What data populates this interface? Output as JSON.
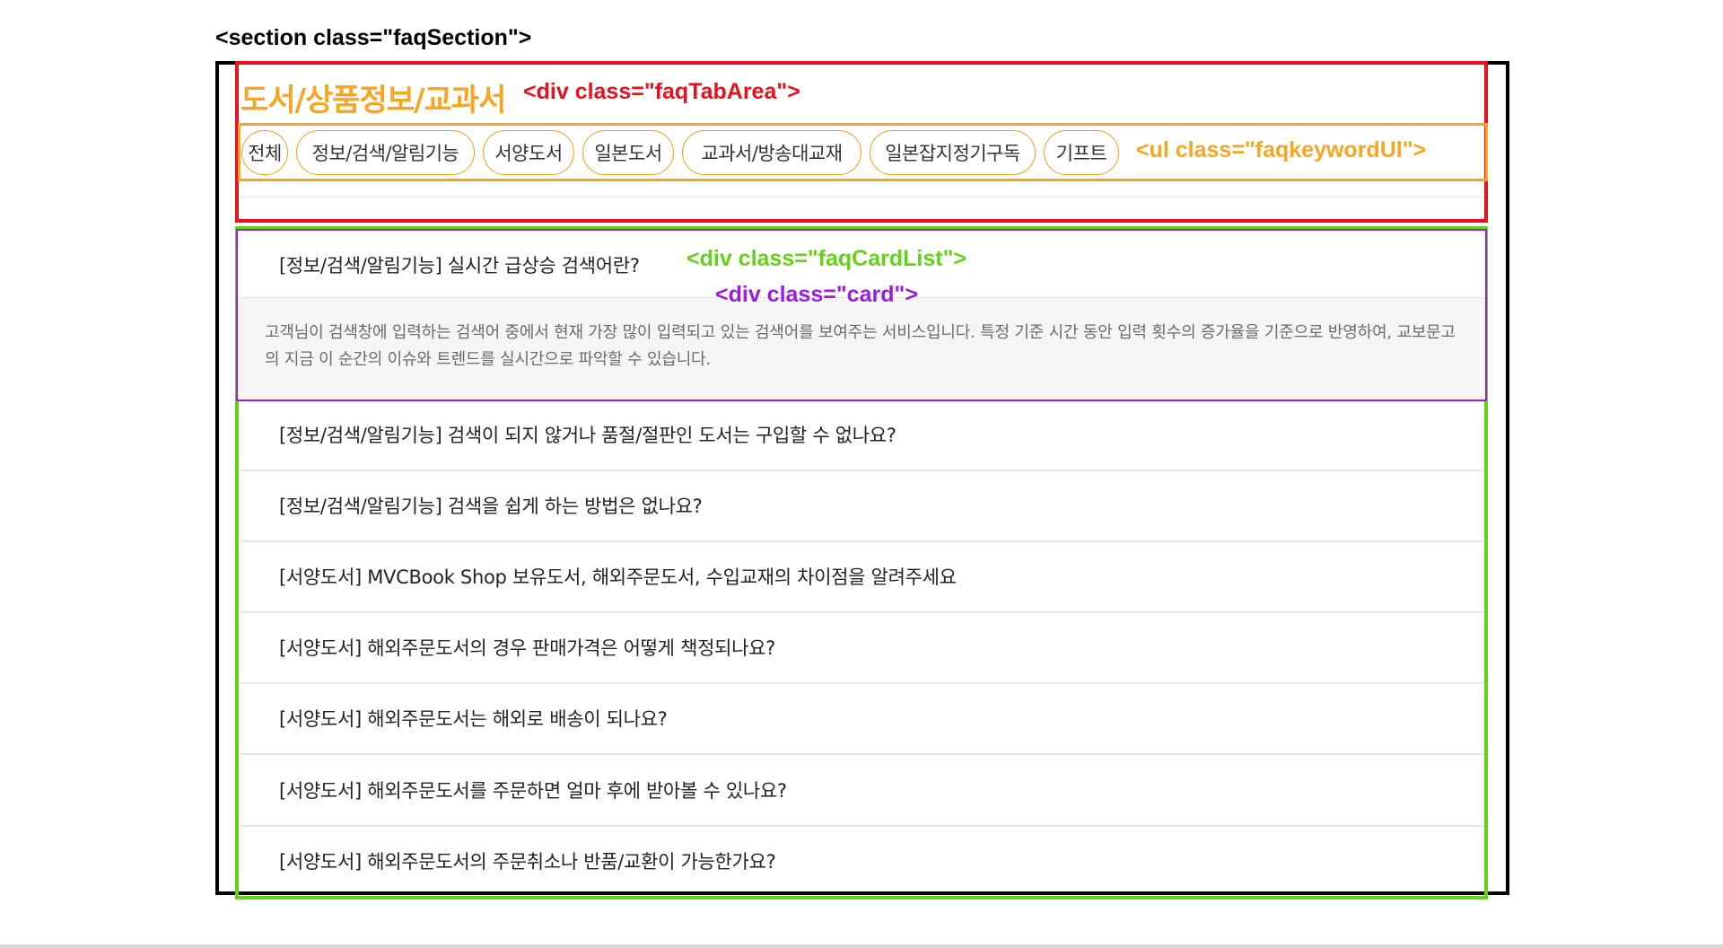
{
  "annotations": {
    "section": "<section class=\"faqSection\">",
    "tab_area": "<div class=\"faqTabArea\">",
    "keyword_ul": "<ul class=\"faqkeywordUl\">",
    "card_list": "<div class=\"faqCardList\">",
    "card": "<div class=\"card\">"
  },
  "colors": {
    "section": "#000000",
    "tab_area": "#e8121e",
    "keyword_ul": "#f5a623",
    "card_list": "#65d21a",
    "card": "#9b1de0"
  },
  "tab_title": "도서/상품정보/교과서",
  "keywords": [
    "전체",
    "정보/검색/알림기능",
    "서양도서",
    "일본도서",
    "교과서/방송대교재",
    "일본잡지정기구독",
    "기프트"
  ],
  "faq_items": [
    {
      "question": "[정보/검색/알림기능] 실시간 급상승 검색어란?"
    },
    {
      "question": "[정보/검색/알림기능] 검색이 되지 않거나 품절/절판인 도서는 구입할 수 없나요?"
    },
    {
      "question": "[정보/검색/알림기능] 검색을 쉽게 하는 방법은 없나요?"
    },
    {
      "question": "[서양도서] MVCBook Shop 보유도서, 해외주문도서, 수입교재의 차이점을 알려주세요"
    },
    {
      "question": "[서양도서] 해외주문도서의 경우 판매가격은 어떻게 책정되나요?"
    },
    {
      "question": "[서양도서] 해외주문도서는 해외로 배송이 되나요?"
    },
    {
      "question": "[서양도서] 해외주문도서를 주문하면 얼마 후에 받아볼 수 있나요?"
    },
    {
      "question": "[서양도서] 해외주문도서의 주문취소나 반품/교환이 가능한가요?"
    }
  ],
  "open_answer": "고객님이 검색창에 입력하는 검색어 중에서 현재 가장 많이 입력되고 있는 검색어를 보여주는 서비스입니다. 특정 기준 시간 동안 입력 횟수의 증가율을 기준으로 반영하여, 교보문고의 지금 이 순간의 이슈와 트렌드를 실시간으로 파악할 수 있습니다."
}
